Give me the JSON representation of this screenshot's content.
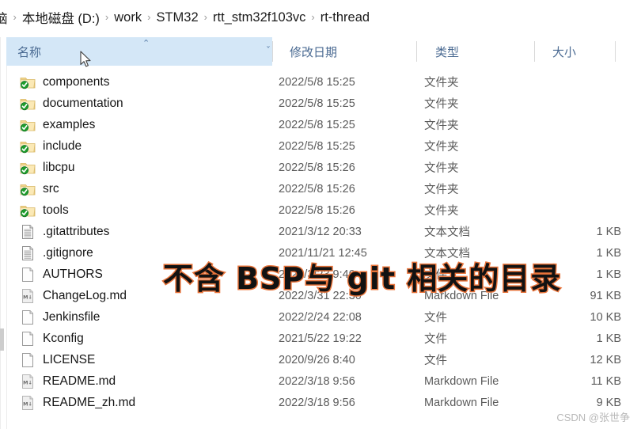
{
  "breadcrumb": {
    "separator": "›",
    "items": [
      {
        "label": "脑",
        "clipped": true
      },
      {
        "label": "本地磁盘 (D:)",
        "clipped": false
      },
      {
        "label": "work",
        "clipped": false
      },
      {
        "label": "STM32",
        "clipped": false
      },
      {
        "label": "rtt_stm32f103vc",
        "clipped": false
      },
      {
        "label": "rt-thread",
        "clipped": false
      }
    ]
  },
  "columns": {
    "name": "名称",
    "date_modified": "修改日期",
    "type": "类型",
    "size": "大小",
    "sort_caret": "⌃",
    "name_chevron": "ˇ",
    "sorted_by": "name",
    "sort_direction": "ascending",
    "highlight_color": "#d4e7f7",
    "header_text_color": "#4a6a92"
  },
  "rows": [
    {
      "icon": "folder-synced-icon",
      "name": "components",
      "date": "2022/5/8 15:25",
      "type": "文件夹",
      "size": ""
    },
    {
      "icon": "folder-synced-icon",
      "name": "documentation",
      "date": "2022/5/8 15:25",
      "type": "文件夹",
      "size": ""
    },
    {
      "icon": "folder-synced-icon",
      "name": "examples",
      "date": "2022/5/8 15:25",
      "type": "文件夹",
      "size": ""
    },
    {
      "icon": "folder-synced-icon",
      "name": "include",
      "date": "2022/5/8 15:25",
      "type": "文件夹",
      "size": ""
    },
    {
      "icon": "folder-synced-icon",
      "name": "libcpu",
      "date": "2022/5/8 15:26",
      "type": "文件夹",
      "size": ""
    },
    {
      "icon": "folder-synced-icon",
      "name": "src",
      "date": "2022/5/8 15:26",
      "type": "文件夹",
      "size": ""
    },
    {
      "icon": "folder-synced-icon",
      "name": "tools",
      "date": "2022/5/8 15:26",
      "type": "文件夹",
      "size": ""
    },
    {
      "icon": "text-file-icon",
      "name": ".gitattributes",
      "date": "2021/3/12 20:33",
      "type": "文本文档",
      "size": "1 KB"
    },
    {
      "icon": "text-file-icon",
      "name": ".gitignore",
      "date": "2021/11/21 12:45",
      "type": "文本文档",
      "size": "1 KB"
    },
    {
      "icon": "blank-file-icon",
      "name": "AUTHORS",
      "date": "2021/3/23 9:40",
      "type": "文件",
      "size": "1 KB"
    },
    {
      "icon": "markdown-file-icon",
      "name": "ChangeLog.md",
      "date": "2022/3/31 22:30",
      "type": "Markdown File",
      "size": "91 KB"
    },
    {
      "icon": "blank-file-icon",
      "name": "Jenkinsfile",
      "date": "2022/2/24 22:08",
      "type": "文件",
      "size": "10 KB"
    },
    {
      "icon": "blank-file-icon",
      "name": "Kconfig",
      "date": "2021/5/22 19:22",
      "type": "文件",
      "size": "1 KB"
    },
    {
      "icon": "blank-file-icon",
      "name": "LICENSE",
      "date": "2020/9/26 8:40",
      "type": "文件",
      "size": "12 KB"
    },
    {
      "icon": "markdown-file-icon",
      "name": "README.md",
      "date": "2022/3/18 9:56",
      "type": "Markdown File",
      "size": "11 KB"
    },
    {
      "icon": "markdown-file-icon",
      "name": "README_zh.md",
      "date": "2022/3/18 9:56",
      "type": "Markdown File",
      "size": "9 KB"
    }
  ],
  "annotation": {
    "text": "不含 BSP与 git 相关的目录",
    "fill_color": "#121212",
    "outline_color": "#e8743b"
  },
  "watermark": {
    "text": "CSDN @张世争"
  }
}
